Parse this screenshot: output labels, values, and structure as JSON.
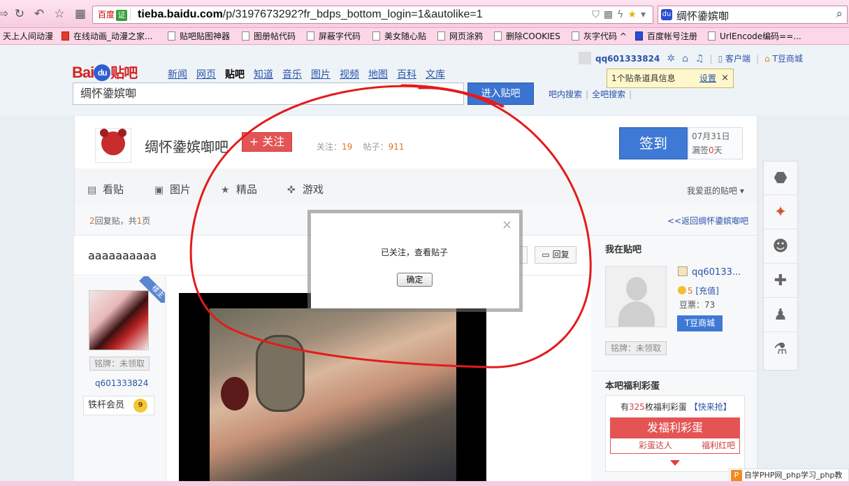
{
  "browser": {
    "site_badge": "百度",
    "verify_label": "证",
    "url_host": "tieba.baidu.com",
    "url_path": "/p/3197673292?fr_bdps_bottom_login=1&autolike=1",
    "search_query": "绸怀鍌嫔啣"
  },
  "bookmarks": [
    "天上人间动漫",
    "在线动画_动漫之家...",
    "贴吧贴图神器",
    "图册帖代码",
    "屏蔽字代码",
    "美女随心贴",
    "网页涂鸦",
    "删除COOKIES",
    "灰字代码 ^",
    "百度帐号注册",
    "UrlEncode编码==..."
  ],
  "header": {
    "logo_text": "Bai",
    "logo_du": "du",
    "logo_tieba": "贴吧",
    "nav": [
      "新闻",
      "网页",
      "贴吧",
      "知道",
      "音乐",
      "图片",
      "视频",
      "地图",
      "百科",
      "文库"
    ],
    "search_value": "绸怀鍌嫔啣",
    "enter_label": "进入贴吧",
    "search_in_forum": "吧内搜索",
    "search_all": "全吧搜索",
    "username": "qq601333824",
    "client_label": "客户端",
    "mall_label": "T豆商城",
    "tip_text": "1个贴条道具信息",
    "tip_settings": "设置",
    "tip_close": "×"
  },
  "forum": {
    "name": "绸怀鍌嫔啣吧",
    "follow_label": "+ 关注",
    "follow_count_label": "关注：",
    "follow_count": "19",
    "posts_label": "帖子：",
    "posts_count": "911",
    "sign_label": "签到",
    "sign_date": "07月31日",
    "sign_missed_prefix": "漏签",
    "sign_missed_days": "0",
    "sign_missed_suffix": "天",
    "tabs": [
      "看贴",
      "图片",
      "精品",
      "游戏"
    ],
    "my_forums": "我爱逛的贴吧 ▾"
  },
  "thread": {
    "reply_count": "2",
    "reply_text": "回复贴，共",
    "page_count": "1",
    "page_suffix": "页",
    "back_link": "<<返回绸怀鍌嫔啣吧",
    "title": "aaaaaaaaaa",
    "reply_label": "回复",
    "lz_label": "楼主",
    "author_badge": "铭牌：未领取",
    "author_name": "q601333824",
    "author_level": "铁杆会员",
    "author_level_num": "9"
  },
  "sidebar": {
    "title": "我在贴吧",
    "username": "qq60133...",
    "coins": "5",
    "recharge": "[充值]",
    "beans": "豆票：73",
    "mall": "T豆商城",
    "badge": "铭牌：未领取",
    "lottery_title": "本吧福利彩蛋",
    "lottery_prefix": "有",
    "lottery_count": "325",
    "lottery_mid": "枚福利彩蛋",
    "lottery_link": "【快来抢】",
    "lottery_btn": "发福利彩蛋",
    "lottery_left": "彩蛋达人",
    "lottery_right": "福利红吧"
  },
  "float_tools": [
    {
      "icon": "location-pin-icon",
      "glyph": "⬣"
    },
    {
      "icon": "magic-wand-icon",
      "glyph": "✦"
    },
    {
      "icon": "bear-face-icon",
      "glyph": "☻"
    },
    {
      "icon": "plus-icon",
      "glyph": "✚"
    },
    {
      "icon": "user-follow-icon",
      "glyph": "♟"
    },
    {
      "icon": "flask-icon",
      "glyph": "⚗"
    }
  ],
  "modal": {
    "message": "已关注，查看贴子",
    "ok_label": "确定",
    "close": "×"
  },
  "watermark": "自学PHP网_php学习_php教"
}
